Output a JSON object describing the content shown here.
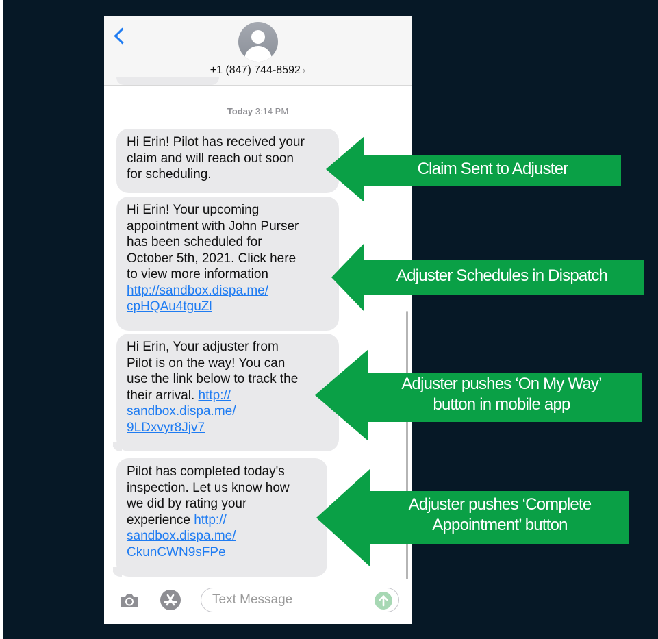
{
  "colors": {
    "background": "#061826",
    "arrow_green": "#0aa046",
    "link_blue": "#1f7cf2",
    "bubble_gray": "#e9e9eb"
  },
  "header": {
    "back_icon": "chevron-left-icon",
    "avatar_icon": "person-icon",
    "contact_number": "+1 (847) 744-8592",
    "contact_chevron": "›"
  },
  "thread": {
    "timestamp_day": "Today",
    "timestamp_time": "3:14 PM",
    "messages": [
      {
        "lines": [
          "Hi Erin! Pilot has received your",
          "claim and will reach out soon",
          "for scheduling."
        ]
      },
      {
        "lines": [
          "Hi Erin! Your upcoming",
          "appointment with John Purser",
          "has been scheduled for",
          "October 5th, 2021. Click here",
          "to view more information"
        ],
        "link_lines": [
          "http://sandbox.dispa.me/",
          "cpHQAu4tguZl"
        ]
      },
      {
        "lines": [
          "Hi Erin, Your adjuster from",
          "Pilot is on the way! You can",
          "use the link below to track the"
        ],
        "line4_text": "their arrival. ",
        "line4_link": "http://",
        "link_lines": [
          "sandbox.dispa.me/",
          "9LDxvyr8Jjv7"
        ]
      },
      {
        "lines": [
          "Pilot has completed today's",
          "inspection. Let us know how",
          "we did by rating your"
        ],
        "line4_text": "experience ",
        "line4_link": "http://",
        "link_lines": [
          "sandbox.dispa.me/",
          "CkunCWN9sFPe"
        ]
      }
    ]
  },
  "input_bar": {
    "camera_icon": "camera-icon",
    "apps_icon": "app-store-icon",
    "placeholder": "Text Message",
    "send_icon": "send-arrow-icon"
  },
  "annotations": [
    {
      "lines": [
        "Claim Sent to Adjuster"
      ]
    },
    {
      "lines": [
        "Adjuster Schedules in Dispatch"
      ]
    },
    {
      "lines": [
        "Adjuster pushes ‘On My Way’",
        "button in mobile app"
      ]
    },
    {
      "lines": [
        "Adjuster pushes ‘Complete",
        "Appointment’ button"
      ]
    }
  ]
}
